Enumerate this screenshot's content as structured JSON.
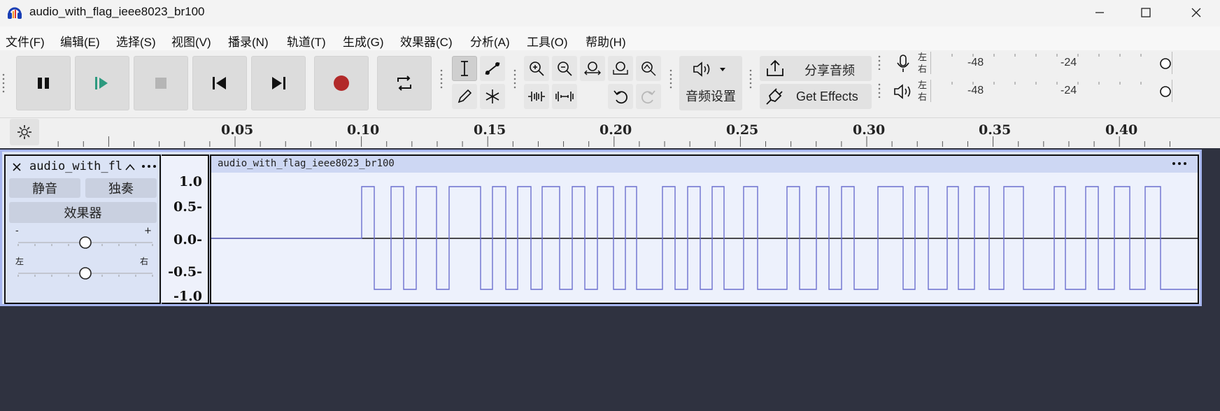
{
  "window": {
    "title": "audio_with_flag_ieee8023_br100"
  },
  "menu": [
    {
      "label": "文件(F)"
    },
    {
      "label": "编辑(E)"
    },
    {
      "label": "选择(S)"
    },
    {
      "label": "视图(V)"
    },
    {
      "label": "播录(N)"
    },
    {
      "label": "轨道(T)"
    },
    {
      "label": "生成(G)"
    },
    {
      "label": "效果器(C)"
    },
    {
      "label": "分析(A)"
    },
    {
      "label": "工具(O)"
    },
    {
      "label": "帮助(H)"
    }
  ],
  "toolbar": {
    "audio_setup_label": "音频设置",
    "share_audio_label": "分享音频",
    "get_effects_label": "Get Effects"
  },
  "meters": {
    "left_label": "左",
    "right_label": "右",
    "record_ticks": [
      "-48",
      "-24"
    ],
    "playback_ticks": [
      "-48",
      "-24"
    ]
  },
  "ruler": {
    "labels": [
      "0.05",
      "0.10",
      "0.15",
      "0.20",
      "0.25",
      "0.30",
      "0.35",
      "0.40"
    ]
  },
  "track": {
    "name": "audio_with_fl",
    "mute_label": "静音",
    "solo_label": "独奏",
    "effects_label": "效果器",
    "gain_minus": "-",
    "gain_plus": "+",
    "pan_left": "左",
    "pan_right": "右",
    "clip_name": "audio_with_flag_ieee8023_br100",
    "scale_labels": [
      "1.0",
      "0.5-",
      "0.0-",
      "-0.5-",
      "-1.0"
    ]
  },
  "colors": {
    "waveform": "#6b6fcf",
    "record_button": "#b22a2a",
    "play_button": "#2d9a7f",
    "track_selected_border": "#a6b5ee",
    "workspace_bg": "#2f3240"
  }
}
